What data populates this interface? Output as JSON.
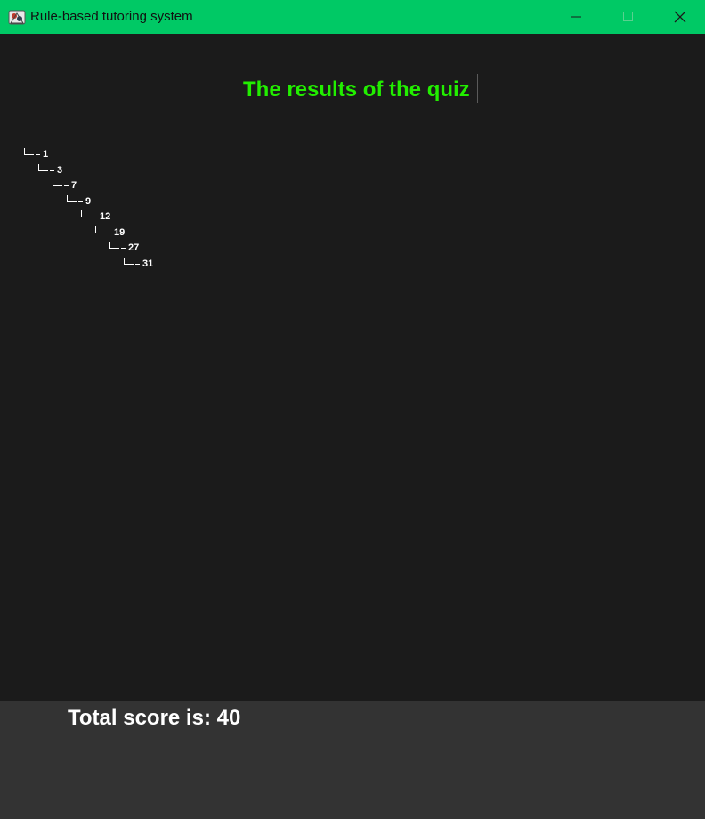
{
  "window": {
    "title": "Rule-based tutoring system",
    "icon": "java-app-icon",
    "controls": [
      "minimize-icon",
      "maximize-icon",
      "close-icon"
    ]
  },
  "main": {
    "heading": "The results of the quiz",
    "heading_color": "#22ee00",
    "tree": [
      {
        "branch": "└─",
        "value": "1"
      },
      {
        "branch": "└─",
        "value": "3"
      },
      {
        "branch": "└─",
        "value": "7"
      },
      {
        "branch": "└─",
        "value": "9"
      },
      {
        "branch": "└─",
        "value": "12"
      },
      {
        "branch": "└─",
        "value": "19"
      },
      {
        "branch": "└─",
        "value": "27"
      },
      {
        "branch": "└─",
        "value": "31"
      }
    ]
  },
  "footer": {
    "score_text": "Total score is: 40"
  },
  "colors": {
    "titlebar": "#00c965",
    "content_bg": "#1b1b1b",
    "footer_bg": "#333333"
  }
}
